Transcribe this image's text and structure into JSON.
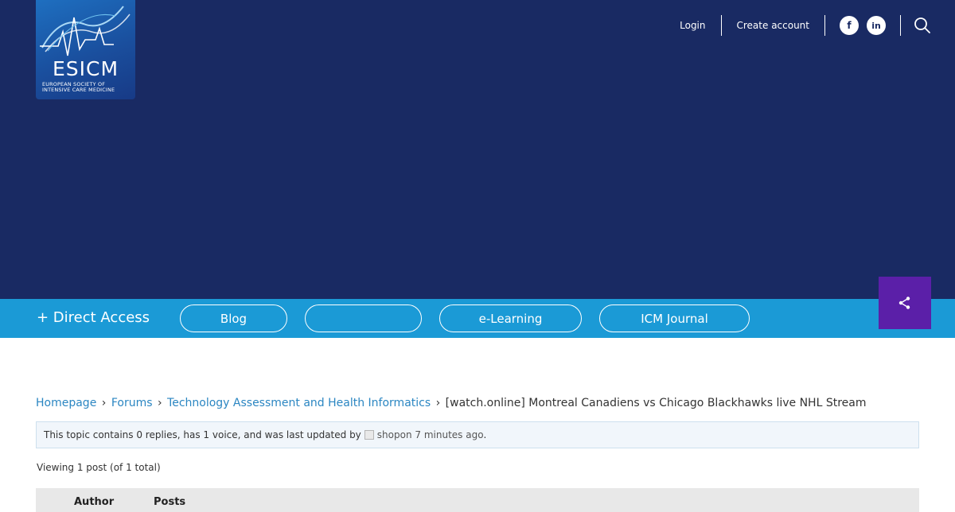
{
  "logo": {
    "name": "ESICM",
    "subtitle_line1": "EUROPEAN SOCIETY OF",
    "subtitle_line2": "INTENSIVE CARE MEDICINE"
  },
  "topnav": {
    "login": "Login",
    "create_account": "Create account"
  },
  "social": {
    "facebook_glyph": "f",
    "linkedin_glyph": "in"
  },
  "quicknav": {
    "direct_access": "+ Direct Access",
    "items": [
      {
        "label": "Blog"
      },
      {
        "label": ""
      },
      {
        "label": "e-Learning"
      },
      {
        "label": "ICM Journal"
      }
    ]
  },
  "breadcrumb": {
    "home": "Homepage",
    "forums": "Forums",
    "category": "Technology Assessment and Health Informatics",
    "current": "[watch.online] Montreal Canadiens vs Chicago Blackhawks live NHL Stream",
    "separator": "›"
  },
  "topic_info": {
    "text_before": "This topic contains 0 replies, has 1 voice, and was last updated by",
    "user": "shopon",
    "time": "7 minutes ago",
    "suffix": "."
  },
  "viewing": "Viewing 1 post (of 1 total)",
  "table": {
    "col_author": "Author",
    "col_posts": "Posts"
  },
  "colors": {
    "hero_bg": "#192a63",
    "strip_bg": "#1b9ad6",
    "share_bg": "#5b1fa8",
    "link": "#2b86c2"
  },
  "icons": {
    "search": "search-icon",
    "share": "share-icon",
    "facebook": "facebook-icon",
    "linkedin": "linkedin-icon"
  }
}
